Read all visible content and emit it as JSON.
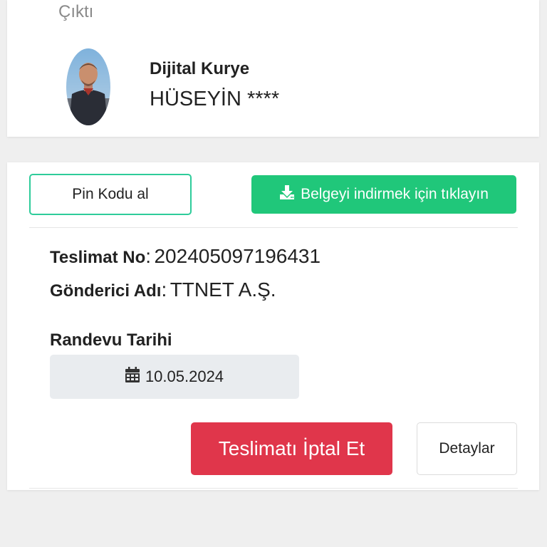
{
  "header": {
    "label": "Çıktı"
  },
  "courier": {
    "role": "Dijital Kurye",
    "name": "HÜSEYİN ****"
  },
  "actions": {
    "pin_button": "Pin Kodu al",
    "download_button": "Belgeyi indirmek için tıklayın"
  },
  "delivery": {
    "number_label": "Teslimat No",
    "number_value": "202405097196431",
    "sender_label": "Gönderici Adı",
    "sender_value": "TTNET A.Ş.",
    "separator": ":"
  },
  "appointment": {
    "label": "Randevu Tarihi",
    "date": "10.05.2024"
  },
  "footer_actions": {
    "cancel_button": "Teslimatı İptal Et",
    "details_button": "Detaylar"
  },
  "icons": {
    "download": "download-icon",
    "calendar": "calendar-icon"
  },
  "colors": {
    "background": "#efefef",
    "primary_green": "#20c77a",
    "outline_green": "#2ecc9a",
    "danger_red": "#e0364b",
    "date_box": "#e9ecef"
  }
}
